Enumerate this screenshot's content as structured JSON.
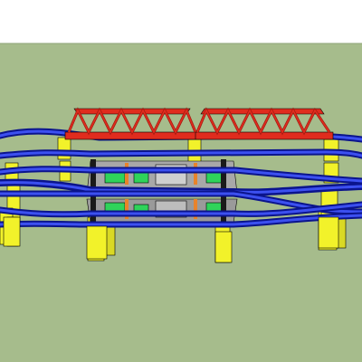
{
  "scene": {
    "colors": {
      "sky": "#ffffff",
      "ground": "#a6bc8c",
      "track": "#1f2fd8",
      "track_dark": "#0b148c",
      "track_light": "#3c50f0",
      "pier": "#f2f22a",
      "pier_shadow": "#b9b91c",
      "bridge": "#e02c1e",
      "bridge_dark": "#a01a10",
      "deck": "#a8a8a8",
      "deck_dark": "#6e6e6e",
      "module": "#2fd35a",
      "module_dark": "#1c8c3a",
      "connector": "#e8832a",
      "post": "#1a1a1a",
      "outline": "#000000"
    }
  }
}
